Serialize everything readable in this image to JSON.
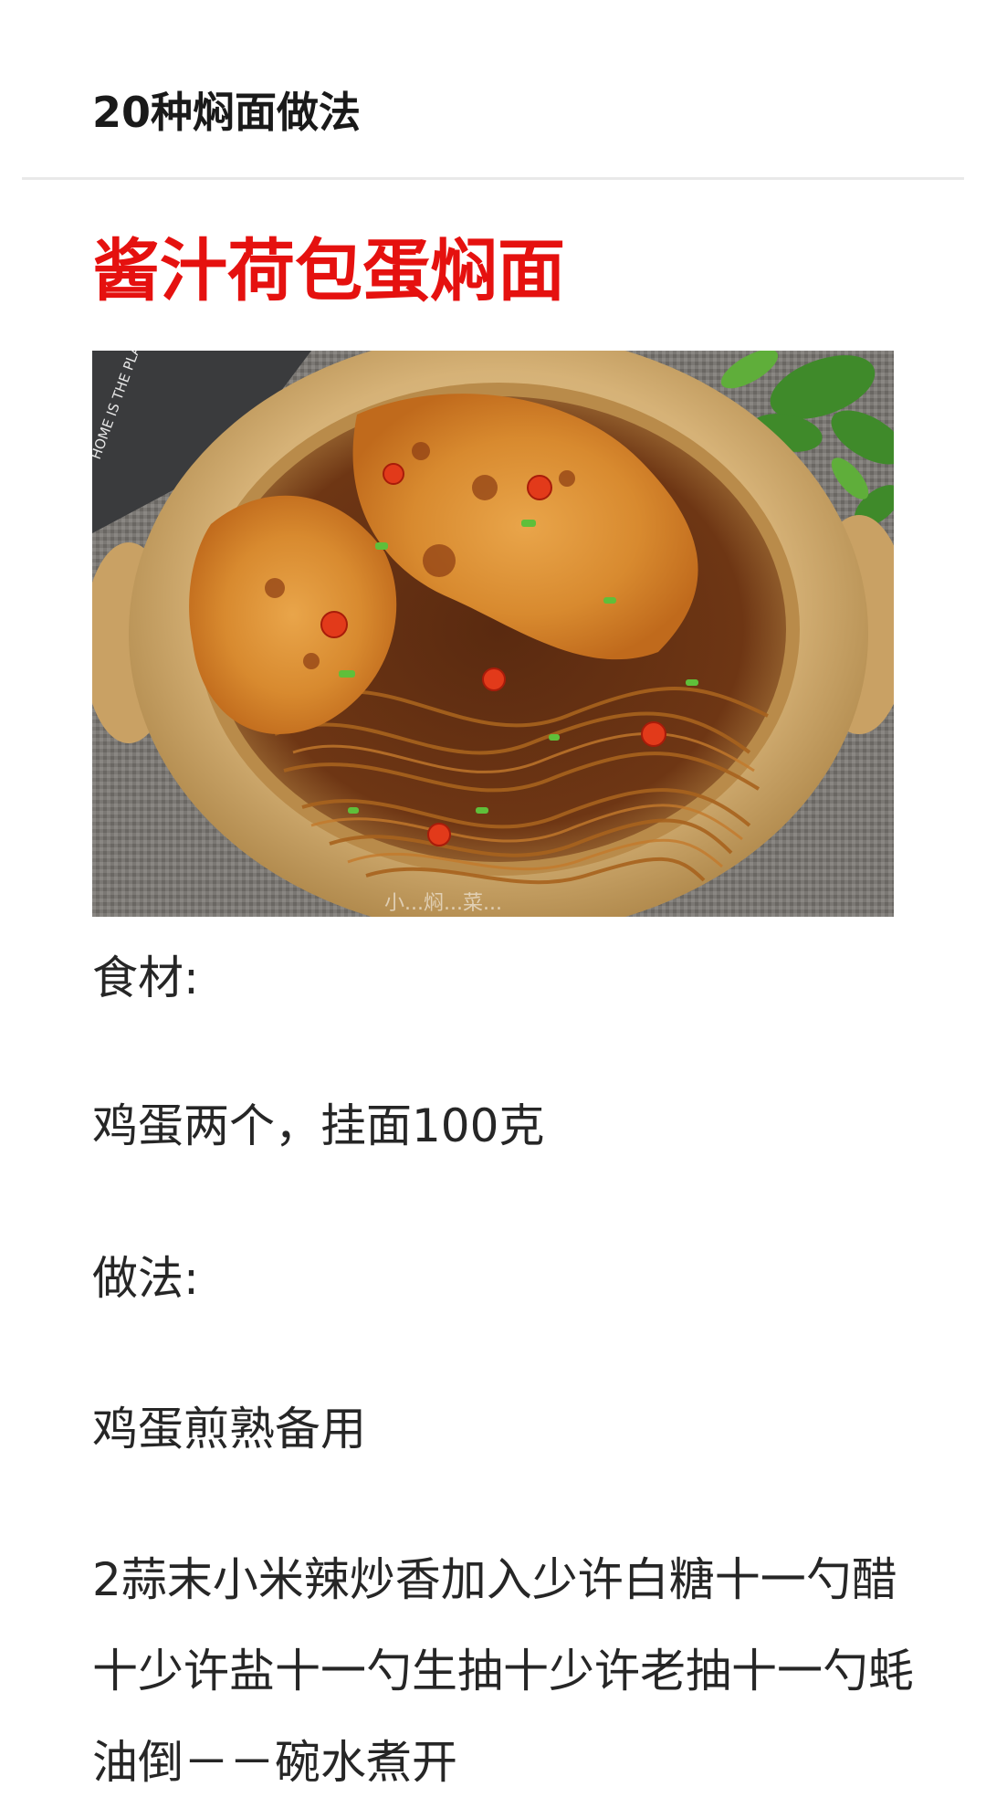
{
  "article": {
    "page_title": "20种焖面做法",
    "recipe_title": "酱汁荷包蛋焖面",
    "photo": {
      "icon": "braised-noodle-photo",
      "mat_text": "HOME IS THE PLACE OF LOVE Good ... Have a ...",
      "watermark": "小...焖...菜..."
    },
    "ingredients_label": "食材:",
    "ingredients_text": "鸡蛋两个，挂面100克",
    "method_label": "做法:",
    "step_1": "鸡蛋煎熟备用",
    "step_2": "2蒜末小米辣炒香加入少许白糖十一勺醋十少许盐十一勺生抽十少许老抽十一勺蚝油倒－－碗水煮开"
  },
  "colors": {
    "title_red": "#e5110f",
    "text_dark": "#262626",
    "divider": "#e9e9e9"
  }
}
